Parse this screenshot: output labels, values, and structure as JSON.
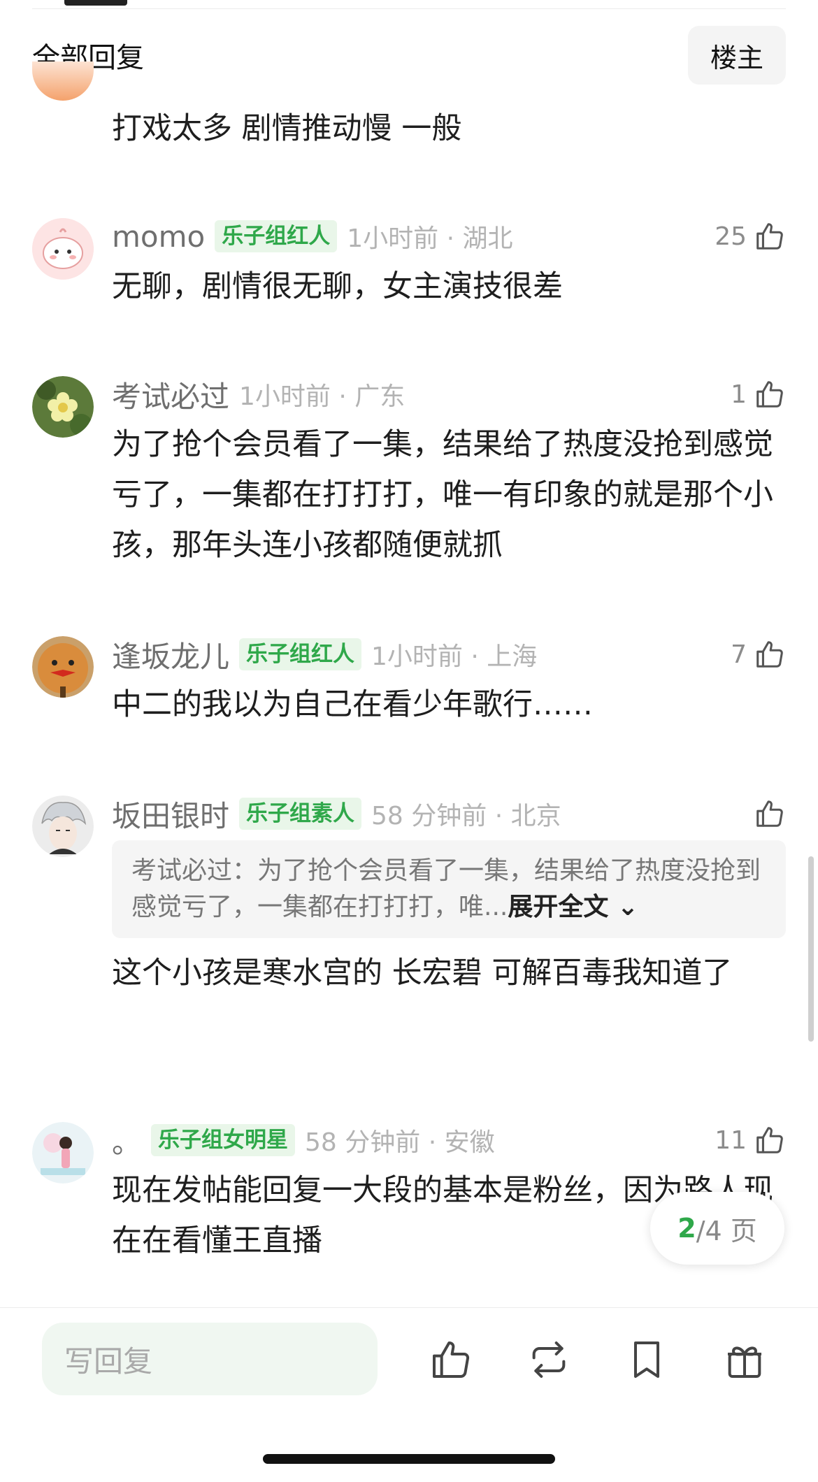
{
  "header": {
    "title": "全部回复",
    "owner_button": "楼主"
  },
  "partial_comment": {
    "text": "打戏太多   剧情推动慢  一般"
  },
  "comments": [
    {
      "username": "momo",
      "badge": "乐子组红人",
      "time": "1小时前 · 湖北",
      "likes": "25",
      "text": "无聊，剧情很无聊，女主演技很差"
    },
    {
      "username": "考试必过",
      "badge": "",
      "time": "1小时前 · 广东",
      "likes": "1",
      "text": "为了抢个会员看了一集，结果给了热度没抢到感觉亏了，一集都在打打打，唯一有印象的就是那个小孩，那年头连小孩都随便就抓"
    },
    {
      "username": "逢坂龙儿",
      "badge": "乐子组红人",
      "time": "1小时前 · 上海",
      "likes": "7",
      "text": "中二的我以为自己在看少年歌行……"
    },
    {
      "username": "坂田银时",
      "badge": "乐子组素人",
      "time": "58 分钟前 · 北京",
      "likes": "",
      "quote": {
        "text": "考试必过：为了抢个会员看了一集，结果给了热度没抢到感觉亏了，一集都在打打打，唯...",
        "expand": "展开全文"
      },
      "text": "这个小孩是寒水宫的 长宏碧 可解百毒我知道了"
    },
    {
      "username": "。",
      "badge": "乐子组女明星",
      "time": "58 分钟前 · 安徽",
      "likes": "11",
      "text": "现在发帖能回复一大段的基本是粉丝，因为路人现在在看懂王直播"
    }
  ],
  "pagination": {
    "current": "2",
    "total": "/4 页"
  },
  "bottom_bar": {
    "reply_placeholder": "写回复",
    "icons": [
      "like-icon",
      "repost-icon",
      "bookmark-icon",
      "gift-icon"
    ]
  },
  "colors": {
    "accent_green": "#2fa84a",
    "badge_bg": "#e9f6e9"
  }
}
